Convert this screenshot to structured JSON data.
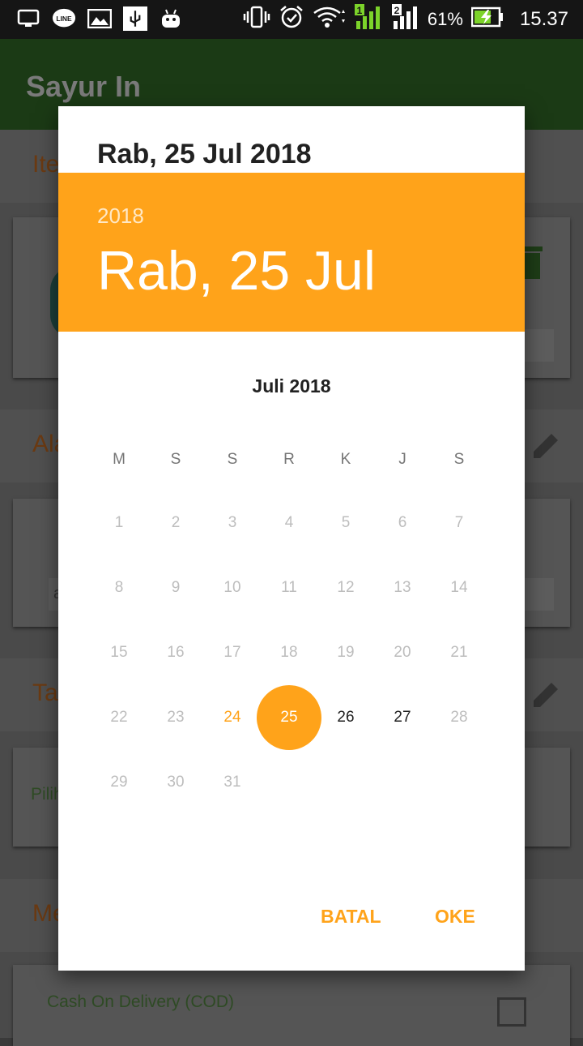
{
  "status_bar": {
    "battery_percent": "61%",
    "time": "15.37",
    "icons_left": [
      "cast-icon",
      "line-app-icon",
      "image-icon",
      "usb-icon",
      "android-icon"
    ],
    "icons_right": [
      "vibrate-icon",
      "alarm-icon",
      "wifi-icon",
      "signal-sim1-icon",
      "signal-sim2-icon",
      "battery-charging-icon"
    ],
    "sim1_label": "1",
    "sim2_label": "2"
  },
  "app": {
    "title": "Sayur In"
  },
  "background": {
    "sections": [
      {
        "label": "Ite"
      },
      {
        "label": "Ala"
      },
      {
        "label": "Ta"
      },
      {
        "label": "Me"
      }
    ],
    "pilih_text": "Pilih",
    "address_prefix": "a",
    "payment_option": "Cash On Delivery (COD)"
  },
  "date_picker": {
    "selected_date_full": "Rab, 25 Jul 2018",
    "year": "2018",
    "header_date": "Rab, 25 Jul",
    "month_title": "Juli 2018",
    "weekdays": [
      "M",
      "S",
      "S",
      "R",
      "K",
      "J",
      "S"
    ],
    "weeks": [
      [
        "1",
        "2",
        "3",
        "4",
        "5",
        "6",
        "7"
      ],
      [
        "8",
        "9",
        "10",
        "11",
        "12",
        "13",
        "14"
      ],
      [
        "15",
        "16",
        "17",
        "18",
        "19",
        "20",
        "21"
      ],
      [
        "22",
        "23",
        "24",
        "25",
        "26",
        "27",
        "28"
      ],
      [
        "29",
        "30",
        "31",
        "",
        "",
        "",
        ""
      ]
    ],
    "today": "24",
    "selected_day": "25",
    "enabled_days": [
      "25",
      "26",
      "27"
    ],
    "cancel_label": "BATAL",
    "ok_label": "OKE",
    "accent_color": "#FFA31A"
  }
}
